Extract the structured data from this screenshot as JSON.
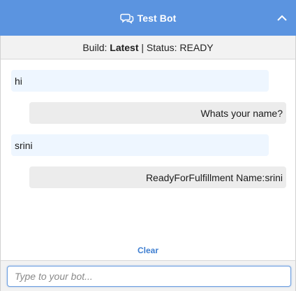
{
  "header": {
    "title": "Test Bot",
    "chat_icon": "chat-bubbles-icon",
    "collapse_icon": "chevron-up-icon",
    "color": "#5b94e0"
  },
  "status": {
    "build_label": "Build:",
    "build_value": "Latest",
    "separator": "|",
    "status_label": "Status:",
    "status_value": "READY"
  },
  "messages": [
    {
      "from": "user",
      "text": "hi"
    },
    {
      "from": "bot",
      "text": "Whats your name?"
    },
    {
      "from": "user",
      "text": "srini"
    },
    {
      "from": "bot",
      "text": "ReadyForFulfillment Name:srini"
    }
  ],
  "clear_label": "Clear",
  "input": {
    "placeholder": "Type to your bot...",
    "value": ""
  }
}
